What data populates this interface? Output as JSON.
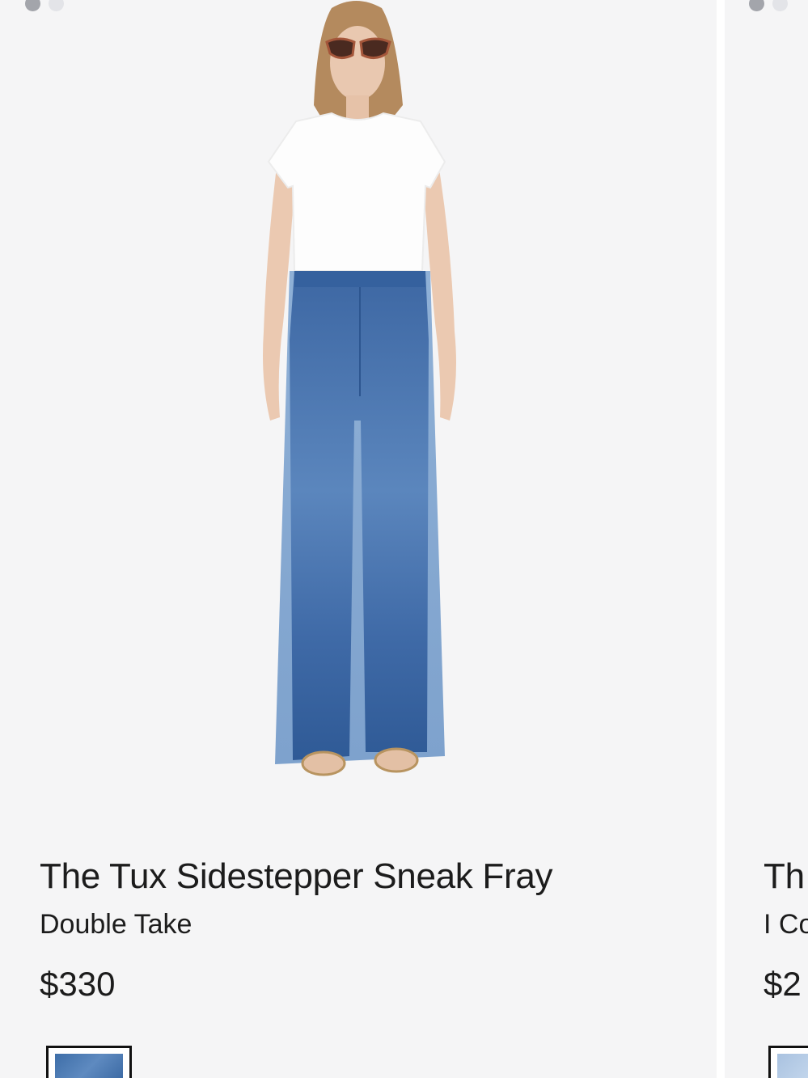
{
  "products": [
    {
      "title": "The Tux Sidestepper Sneak Fray",
      "color": "Double Take",
      "price": "$330",
      "image_dots": 2,
      "active_dot": 1
    },
    {
      "title": "Th",
      "color": "I Co",
      "price": "$2",
      "image_dots": 2,
      "active_dot": 1
    }
  ],
  "colors": {
    "card_background": "#f5f5f6",
    "text": "#1c1c1c",
    "dot_active": "#a3a5ab",
    "dot_inactive": "#e3e4e8",
    "denim_dark": "#3e6ea8",
    "denim_light": "#a9c2e0"
  }
}
